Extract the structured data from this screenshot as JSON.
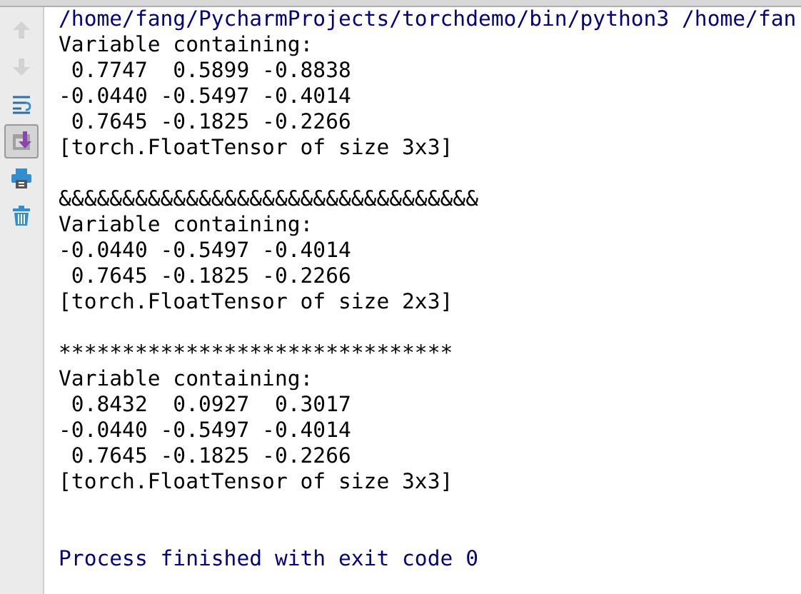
{
  "toolbar": [
    {
      "kind": "up",
      "disabled": true,
      "selected": false
    },
    {
      "kind": "down",
      "disabled": true,
      "selected": false
    },
    {
      "kind": "wrap",
      "disabled": false,
      "selected": false
    },
    {
      "kind": "scroll",
      "disabled": false,
      "selected": true
    },
    {
      "kind": "print",
      "disabled": false,
      "selected": false
    },
    {
      "kind": "trash",
      "disabled": false,
      "selected": false
    }
  ],
  "console": [
    {
      "kind": "system",
      "text": "/home/fang/PycharmProjects/torchdemo/bin/python3 /home/fan"
    },
    {
      "kind": "output",
      "text": "Variable containing:"
    },
    {
      "kind": "output",
      "text": " 0.7747  0.5899 -0.8838"
    },
    {
      "kind": "output",
      "text": "-0.0440 -0.5497 -0.4014"
    },
    {
      "kind": "output",
      "text": " 0.7645 -0.1825 -0.2266"
    },
    {
      "kind": "output",
      "text": "[torch.FloatTensor of size 3x3]"
    },
    {
      "kind": "blank"
    },
    {
      "kind": "output",
      "text": "&&&&&&&&&&&&&&&&&&&&&&&&&&&&&&&&&"
    },
    {
      "kind": "output",
      "text": "Variable containing:"
    },
    {
      "kind": "output",
      "text": "-0.0440 -0.5497 -0.4014"
    },
    {
      "kind": "output",
      "text": " 0.7645 -0.1825 -0.2266"
    },
    {
      "kind": "output",
      "text": "[torch.FloatTensor of size 2x3]"
    },
    {
      "kind": "blank"
    },
    {
      "kind": "output",
      "text": "*******************************"
    },
    {
      "kind": "output",
      "text": "Variable containing:"
    },
    {
      "kind": "output",
      "text": " 0.8432  0.0927  0.3017"
    },
    {
      "kind": "output",
      "text": "-0.0440 -0.5497 -0.4014"
    },
    {
      "kind": "output",
      "text": " 0.7645 -0.1825 -0.2266"
    },
    {
      "kind": "output",
      "text": "[torch.FloatTensor of size 3x3]"
    },
    {
      "kind": "blank"
    },
    {
      "kind": "blank"
    },
    {
      "kind": "system",
      "text": "Process finished with exit code 0"
    }
  ]
}
